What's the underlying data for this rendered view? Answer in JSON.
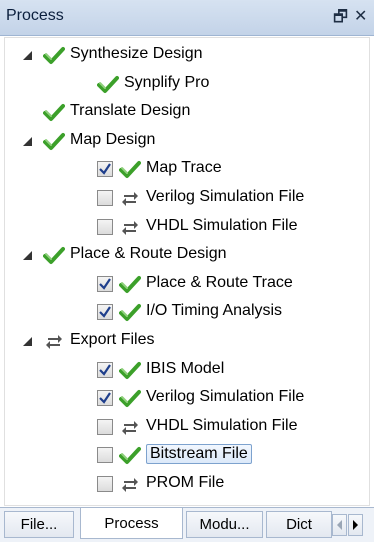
{
  "panel": {
    "title": "Process",
    "float_glyph": "🗗",
    "close_glyph": "✕"
  },
  "tree": [
    {
      "label": "Synthesize Design",
      "icon": "check-icon",
      "expand": "expanded",
      "checkbox": null,
      "level": 0
    },
    {
      "label": "Synplify Pro",
      "icon": "check-icon",
      "expand": null,
      "checkbox": null,
      "level": 1
    },
    {
      "label": "Translate Design",
      "icon": "check-icon",
      "expand": null,
      "checkbox": null,
      "level": 0
    },
    {
      "label": "Map Design",
      "icon": "check-icon",
      "expand": "expanded",
      "checkbox": null,
      "level": 0
    },
    {
      "label": "Map Trace",
      "icon": "check-icon",
      "expand": null,
      "checkbox": true,
      "level": 1
    },
    {
      "label": "Verilog Simulation File",
      "icon": "refresh-icon",
      "expand": null,
      "checkbox": false,
      "level": 1
    },
    {
      "label": "VHDL Simulation File",
      "icon": "refresh-icon",
      "expand": null,
      "checkbox": false,
      "level": 1
    },
    {
      "label": "Place & Route Design",
      "icon": "check-icon",
      "expand": "expanded",
      "checkbox": null,
      "level": 0
    },
    {
      "label": "Place & Route Trace",
      "icon": "check-icon",
      "expand": null,
      "checkbox": true,
      "level": 1
    },
    {
      "label": "I/O Timing Analysis",
      "icon": "check-icon",
      "expand": null,
      "checkbox": true,
      "level": 1
    },
    {
      "label": "Export Files",
      "icon": "refresh-icon",
      "expand": "expanded",
      "checkbox": null,
      "level": 0
    },
    {
      "label": "IBIS Model",
      "icon": "check-icon",
      "expand": null,
      "checkbox": true,
      "level": 1
    },
    {
      "label": "Verilog Simulation File",
      "icon": "check-icon",
      "expand": null,
      "checkbox": true,
      "level": 1
    },
    {
      "label": "VHDL Simulation File",
      "icon": "refresh-icon",
      "expand": null,
      "checkbox": false,
      "level": 1
    },
    {
      "label": "Bitstream File",
      "icon": "check-icon",
      "expand": null,
      "checkbox": false,
      "level": 1,
      "selected": true
    },
    {
      "label": "PROM File",
      "icon": "refresh-icon",
      "expand": null,
      "checkbox": false,
      "level": 1
    }
  ],
  "tabs": [
    {
      "label": "File...",
      "active": false
    },
    {
      "label": "Process",
      "active": true
    },
    {
      "label": "Modu...",
      "active": false
    },
    {
      "label": "Dict",
      "active": false
    }
  ],
  "colors": {
    "check_green": "#3ca02a",
    "title_bar": "#c9d8eb",
    "selection_border": "#7da2ce"
  }
}
